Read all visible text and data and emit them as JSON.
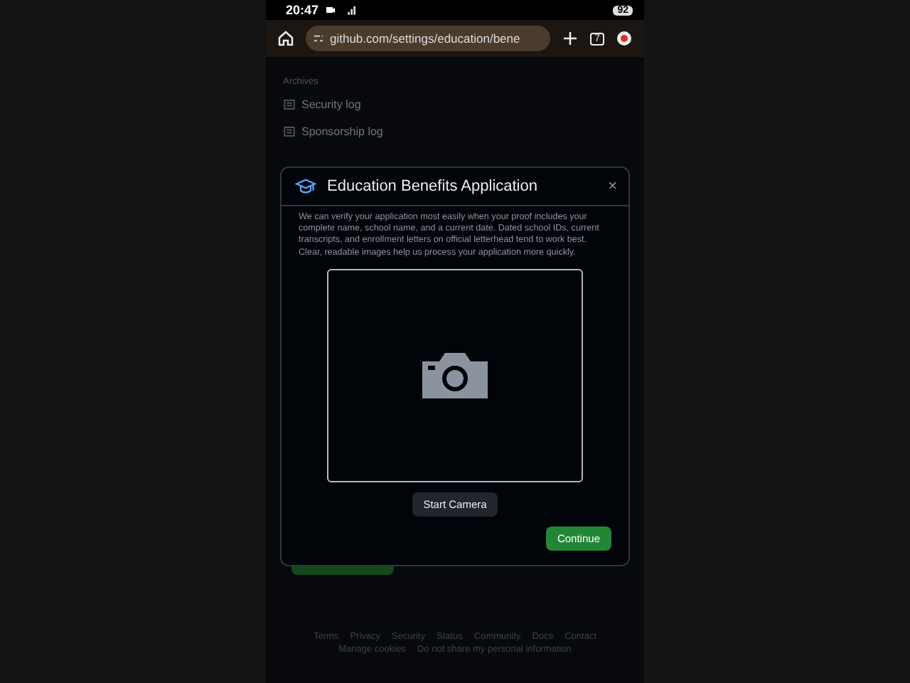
{
  "status_bar": {
    "time": "20:47",
    "battery": "92"
  },
  "browser": {
    "url": "github.com/settings/education/bene",
    "tab_count": "7"
  },
  "sidebar": {
    "section": "Archives",
    "items": [
      {
        "label": "Security log"
      },
      {
        "label": "Sponsorship log"
      }
    ]
  },
  "dialog": {
    "title": "Education Benefits Application",
    "close": "×",
    "description": "We can verify your application most easily when your proof includes your complete name, school name, and a current date. Dated school IDs, current transcripts, and enrollment letters on official letterhead tend to work best. Clear, readable images help us process your application more quickly.",
    "camera_button": "Start Camera",
    "continue_button": "Continue"
  },
  "footer": {
    "links": [
      {
        "label": "Terms"
      },
      {
        "label": "Privacy"
      },
      {
        "label": "Security"
      },
      {
        "label": "Status"
      },
      {
        "label": "Community"
      },
      {
        "label": "Docs"
      },
      {
        "label": "Contact"
      },
      {
        "label": "Manage cookies"
      },
      {
        "label": "Do not share my personal information"
      }
    ]
  }
}
